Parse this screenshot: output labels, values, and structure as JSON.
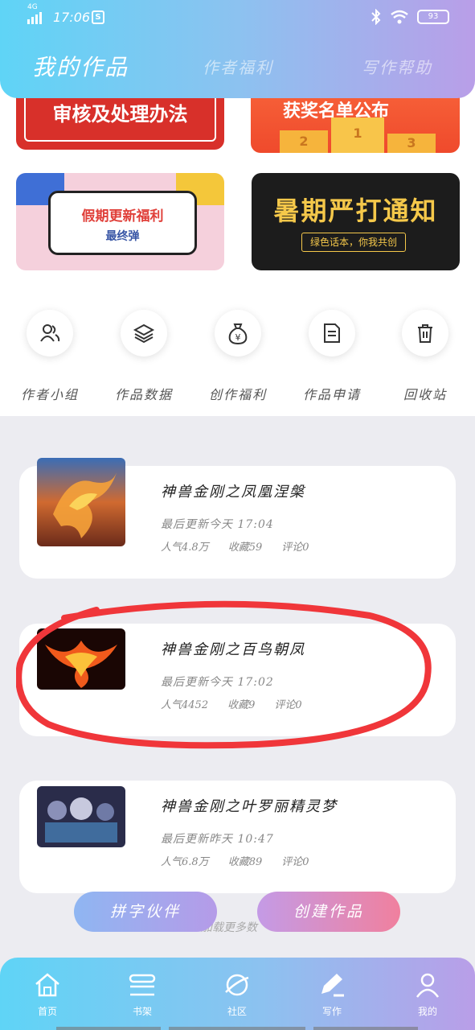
{
  "status_bar": {
    "network": "4G",
    "time": "17:06",
    "app_badge": "S",
    "battery": "93"
  },
  "tabs": [
    {
      "label": "我的作品",
      "active": true
    },
    {
      "label": "作者福利",
      "active": false
    },
    {
      "label": "写作帮助",
      "active": false
    }
  ],
  "banners": {
    "b1": "审核及处理办法",
    "b2": {
      "title": "获奖名单公布",
      "podium": [
        "2",
        "1",
        "3"
      ]
    },
    "b3": {
      "line1": "假期更新福利",
      "line2": "最终弹"
    },
    "b4": {
      "line1": "暑期严打通知",
      "line2": "绿色话本，你我共创"
    }
  },
  "quick_actions": [
    {
      "label": "作者小组",
      "icon": "users-icon"
    },
    {
      "label": "作品数据",
      "icon": "layers-icon"
    },
    {
      "label": "创作福利",
      "icon": "money-bag-icon"
    },
    {
      "label": "作品申请",
      "icon": "document-icon"
    },
    {
      "label": "回收站",
      "icon": "trash-icon"
    }
  ],
  "works": [
    {
      "title": "神兽金刚之凤凰涅槃",
      "updated": "最后更新今天 17:04",
      "popularity": "人气4.8万",
      "favorites": "收藏59",
      "comments": "评论0"
    },
    {
      "title": "神兽金刚之百鸟朝凤",
      "updated": "最后更新今天 17:02",
      "popularity": "人气4452",
      "favorites": "收藏9",
      "comments": "评论0"
    },
    {
      "title": "神兽金刚之叶罗丽精灵梦",
      "updated": "最后更新昨天 10:47",
      "popularity": "人气6.8万",
      "favorites": "收藏89",
      "comments": "评论0"
    }
  ],
  "buttons": {
    "partner": "拼字伙伴",
    "create": "创建作品"
  },
  "load_more": "加载更多数",
  "bottom_nav": [
    {
      "label": "首页",
      "icon": "home-icon"
    },
    {
      "label": "书架",
      "icon": "bookshelf-icon"
    },
    {
      "label": "社区",
      "icon": "planet-icon"
    },
    {
      "label": "写作",
      "icon": "pen-icon"
    },
    {
      "label": "我的",
      "icon": "profile-icon"
    }
  ],
  "colors": {
    "accent_left": "#5fd4f6",
    "accent_right": "#b99ee8",
    "annotation": "#f0363a"
  }
}
